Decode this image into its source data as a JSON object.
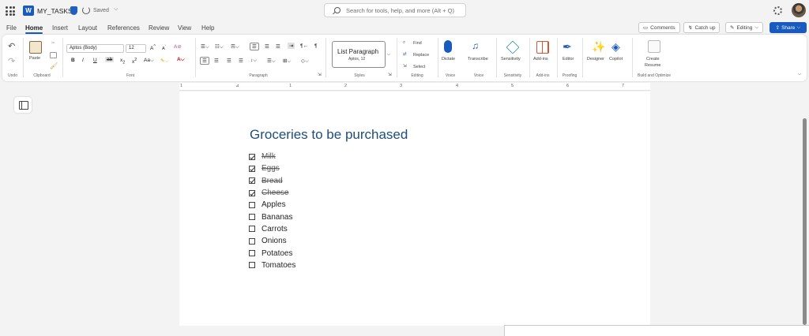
{
  "title_bar": {
    "doc_name": "MY_TASKS",
    "save_status": "Saved",
    "search_placeholder": "Search for tools, help, and more (Alt + Q)"
  },
  "menu": {
    "tabs": [
      "File",
      "Home",
      "Insert",
      "Layout",
      "References",
      "Review",
      "View",
      "Help"
    ],
    "active": "Home",
    "comments": "Comments",
    "catch_up": "Catch up",
    "editing": "Editing",
    "share": "Share"
  },
  "ribbon": {
    "undo_label": "Undo",
    "clipboard": {
      "paste": "Paste",
      "group": "Clipboard"
    },
    "font": {
      "name": "Aptos (Body)",
      "size": "12",
      "group": "Font"
    },
    "paragraph": {
      "group": "Paragraph"
    },
    "styles": {
      "current": "List Paragraph",
      "sub": "Aptos, 12",
      "group": "Styles"
    },
    "editing": {
      "find": "Find",
      "replace": "Replace",
      "select": "Select",
      "group": "Editing"
    },
    "voice": {
      "dictate": "Dictate",
      "group": "Voice"
    },
    "transcribe": {
      "label": "Transcribe",
      "group": "Voice"
    },
    "sensitivity": {
      "label": "Sensitivity",
      "group": "Sensitivity"
    },
    "addins": {
      "label": "Add-ins",
      "group": "Add-ins"
    },
    "editor": {
      "label": "Editor",
      "group": "Proofing"
    },
    "designer": {
      "label": "Designer"
    },
    "copilot": {
      "label": "Copilot"
    },
    "resume": {
      "label1": "Create",
      "label2": "Resume",
      "group": "Build and Optimize"
    }
  },
  "ruler_numbers": [
    "1",
    "1",
    "2",
    "3",
    "4",
    "5",
    "6",
    "7"
  ],
  "document": {
    "heading": "Groceries to be purchased",
    "items": [
      {
        "text": "Milk",
        "checked": true
      },
      {
        "text": "Eggs",
        "checked": true
      },
      {
        "text": "Bread",
        "checked": true
      },
      {
        "text": "Cheese",
        "checked": true
      },
      {
        "text": "Apples",
        "checked": false
      },
      {
        "text": "Bananas",
        "checked": false
      },
      {
        "text": "Carrots",
        "checked": false
      },
      {
        "text": "Onions",
        "checked": false
      },
      {
        "text": "Potatoes",
        "checked": false
      },
      {
        "text": "Tomatoes",
        "checked": false
      }
    ]
  },
  "colors": {
    "accent": "#185abd",
    "heading": "#1f4e79"
  }
}
